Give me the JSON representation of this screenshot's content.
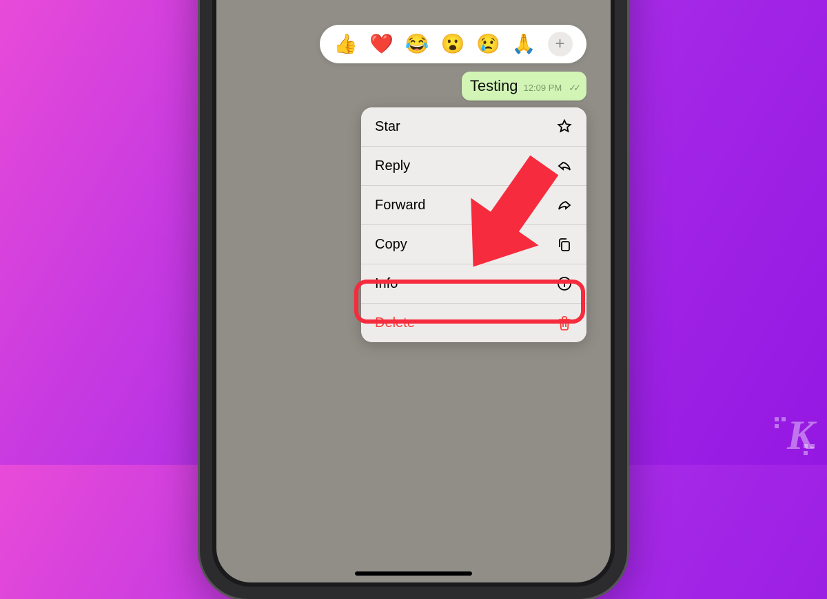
{
  "reactions": {
    "emojis": [
      "👍",
      "❤️",
      "😂",
      "😮",
      "😢",
      "🙏"
    ],
    "plus": "+"
  },
  "message": {
    "text": "Testing",
    "time": "12:09 PM",
    "ticks": "✓✓"
  },
  "menu": {
    "star": "Star",
    "reply": "Reply",
    "forward": "Forward",
    "copy": "Copy",
    "info": "Info",
    "delete": "Delete"
  },
  "watermark": "K"
}
